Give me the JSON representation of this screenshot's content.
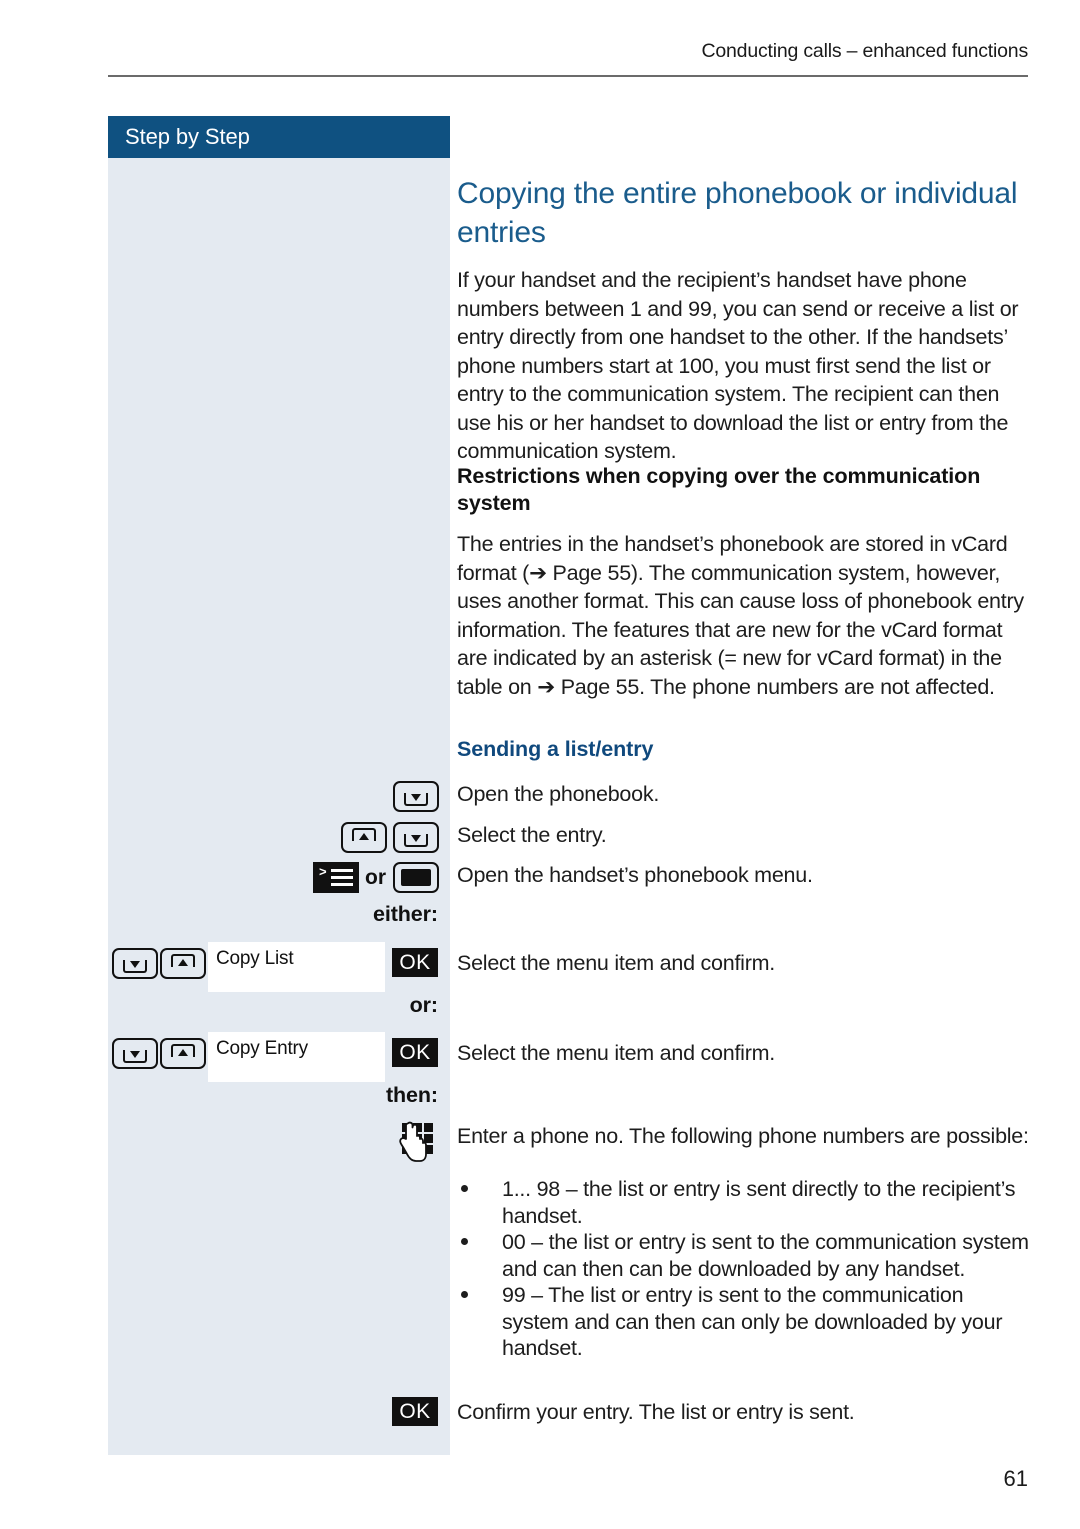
{
  "header": {
    "running_title": "Conducting calls – enhanced functions"
  },
  "sidebar": {
    "title": "Step by Step"
  },
  "document": {
    "title": "Copying the entire phonebook or individual entries",
    "intro_paragraph": "If your handset and the recipient’s handset have phone numbers between 1 and 99, you can send or receive a list or entry directly from one handset to the other. If the handsets’ phone numbers start at 100, you must first send the list or entry to the communication system. The recipient can then use his or her handset to download the list or entry from the communication system.",
    "restrictions_heading": "Restrictions when copying over the communication system",
    "restrictions_paragraph": "The entries in the handset’s phonebook are stored in vCard format (➔ Page 55). The communication system, however, uses another format. This can cause loss of phonebook entry information. The features that are new for the vCard format are indicated by an asterisk (= new for vCard format) in the table on ➔ Page 55. The phone numbers are not affected.",
    "sending_heading": "Sending a list/entry"
  },
  "steps": [
    {
      "icons": [
        "rocker-down-key"
      ],
      "text": "Open the phonebook."
    },
    {
      "icons": [
        "rocker-up-key",
        "rocker-down-key"
      ],
      "text": "Select the entry."
    },
    {
      "icons": [
        "menu-key",
        "or",
        "display-key"
      ],
      "or_label": "or",
      "text": "Open the handset’s phonebook menu."
    }
  ],
  "connectors": {
    "either": "either:",
    "or": "or:",
    "then": "then:"
  },
  "menu_rows": [
    {
      "field_label": "Copy List",
      "ok_label": "OK",
      "text": "Select the menu item and confirm."
    },
    {
      "field_label": "Copy Entry",
      "ok_label": "OK",
      "text": "Select the menu item and confirm."
    }
  ],
  "keypad_step": {
    "icon": "keypad-icon",
    "text_line1": "Enter a phone no. The following phone numbers are",
    "text_line2": "possible:"
  },
  "bullets": [
    "1... 98 – the list or entry is sent directly to the recipient’s handset.",
    "00 – the list or entry is sent to the communication system and can then can be downloaded by any handset.",
    "99 – The list or entry is sent to the communication system and can then can only be downloaded by your handset."
  ],
  "confirm_step": {
    "ok_label": "OK",
    "text": "Confirm your entry. The list or entry is sent."
  },
  "footer": {
    "page_number": "61"
  },
  "colors": {
    "sidebar_bg": "#e4eaf1",
    "sidebar_title_bg": "#0f5181",
    "heading_blue": "#1a5c8c",
    "subheading_blue": "#10497d",
    "ok_button_bg": "#111111"
  }
}
